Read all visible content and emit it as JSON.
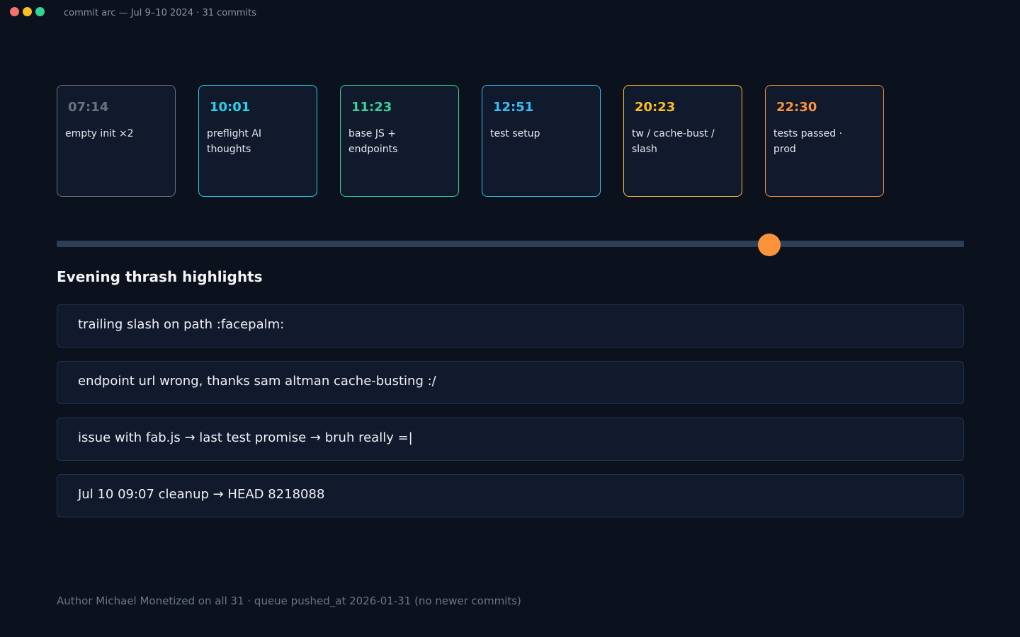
{
  "window": {
    "title": "commit arc — Jul 9–10 2024 · 31 commits"
  },
  "colors": {
    "background": "#0b111d",
    "panel": "#111a2c",
    "gray": "#6b7280",
    "cyan": "#22d3ee",
    "green": "#34d399",
    "sky": "#38bdf8",
    "amber": "#fbbf24",
    "orange": "#fb923c",
    "track": "#2c3e58"
  },
  "timeline": {
    "cards": [
      {
        "time": "07:14",
        "desc": "empty init ×2",
        "color": "#6b7280"
      },
      {
        "time": "10:01",
        "desc": "preflight AI thoughts",
        "color": "#22d3ee"
      },
      {
        "time": "11:23",
        "desc": "base JS + endpoints",
        "color": "#34d399"
      },
      {
        "time": "12:51",
        "desc": "test setup",
        "color": "#38bdf8"
      },
      {
        "time": "20:23",
        "desc": "tw / cache-bust / slash",
        "color": "#fbbf24"
      },
      {
        "time": "22:30",
        "desc": "tests passed · prod",
        "color": "#fb923c"
      }
    ],
    "slider_fraction": 0.785
  },
  "highlights": {
    "title": "Evening thrash highlights",
    "items": [
      "trailing slash on path :facepalm:",
      "endpoint url wrong, thanks sam altman cache-busting :/",
      "issue with fab.js → last test promise → bruh really =|",
      "Jul 10 09:07 cleanup → HEAD 8218088"
    ]
  },
  "footer": {
    "text": "Author Michael Monetized on all 31 · queue pushed_at 2026-01-31 (no newer commits)"
  }
}
